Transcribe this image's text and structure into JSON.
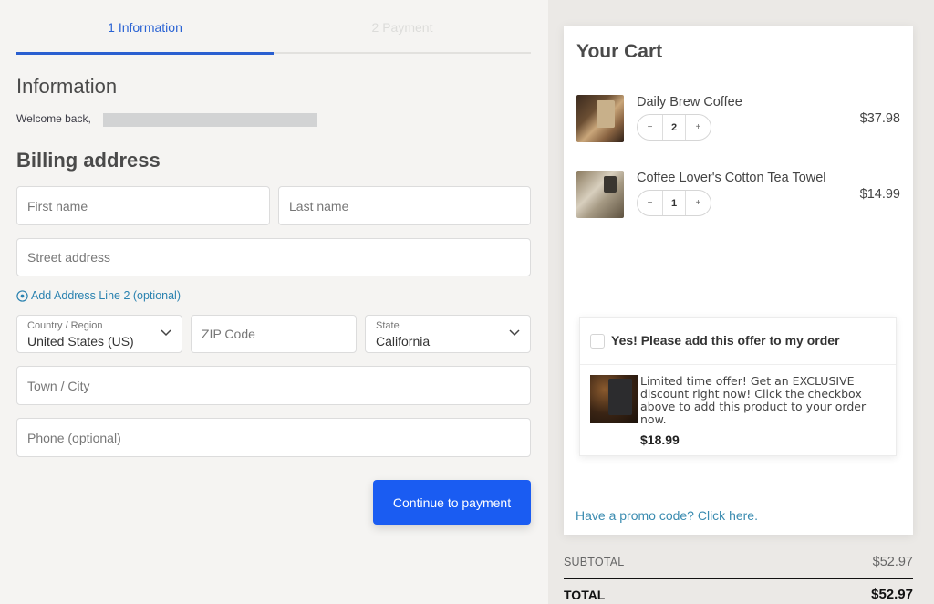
{
  "steps": [
    {
      "label": "1 Information",
      "state": "active"
    },
    {
      "label": "2 Payment",
      "state": "inactive"
    }
  ],
  "information": {
    "heading": "Information",
    "welcome_text": "Welcome back,"
  },
  "billing": {
    "heading": "Billing address",
    "first_name_placeholder": "First name",
    "last_name_placeholder": "Last name",
    "street_placeholder": "Street address",
    "add_line_label": "Add Address Line 2 (optional)",
    "country": {
      "label": "Country / Region",
      "value": "United States (US)"
    },
    "zip_placeholder": "ZIP Code",
    "state": {
      "label": "State",
      "value": "California"
    },
    "town_placeholder": "Town / City",
    "phone_placeholder": "Phone (optional)",
    "continue_label": "Continue to payment"
  },
  "cart": {
    "title": "Your Cart",
    "items": [
      {
        "name": "Daily Brew Coffee",
        "quantity": "2",
        "price": "$37.98",
        "minus": "−",
        "plus": "+"
      },
      {
        "name": "Coffee Lover's Cotton Tea Towel",
        "quantity": "1",
        "price": "$14.99",
        "minus": "−",
        "plus": "+"
      }
    ],
    "offer": {
      "checkbox_label": "Yes! Please add this offer to my order",
      "checked": false,
      "description": "Limited time offer! Get an EXCLUSIVE discount right now! Click the checkbox above to add this product to your order now.",
      "price": "$18.99"
    },
    "promo_link": "Have a promo code? Click here."
  },
  "totals": {
    "subtotal_label": "SUBTOTAL",
    "subtotal_value": "$52.97",
    "total_label": "TOTAL",
    "total_value": "$52.97"
  },
  "colors": {
    "accent": "#1a5cf2",
    "step_active": "#2a63d4",
    "link": "#2a82b0"
  }
}
